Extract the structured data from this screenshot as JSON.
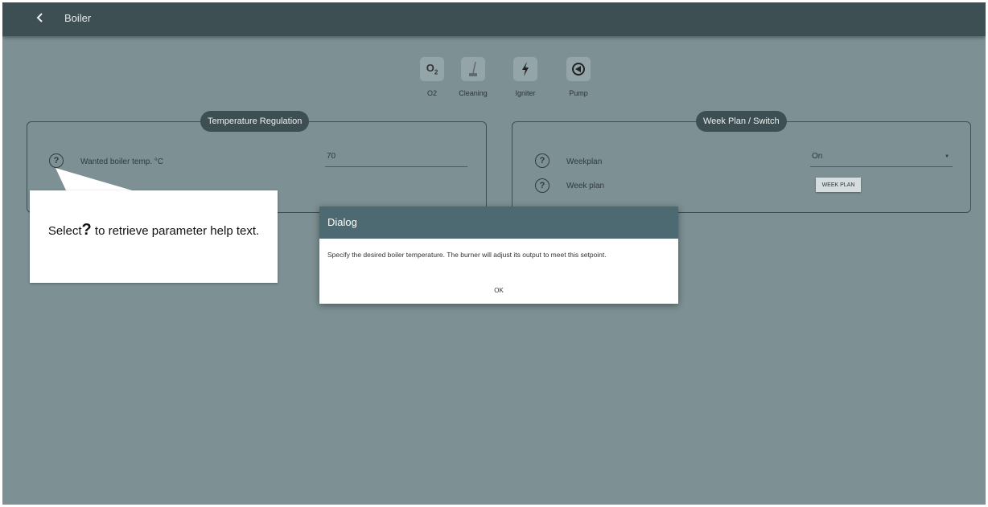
{
  "header": {
    "back_icon": "chevron-left-icon",
    "title": "Boiler"
  },
  "devices": [
    {
      "label": "O2",
      "icon": "o2-icon"
    },
    {
      "label": "Cleaning",
      "icon": "broom-icon"
    },
    {
      "label": "Igniter",
      "icon": "lightning-icon"
    },
    {
      "label": "Pump",
      "icon": "pump-icon"
    }
  ],
  "temp_panel": {
    "title": "Temperature Regulation",
    "param_label": "Wanted boiler temp. °C",
    "value": "70"
  },
  "week_panel": {
    "title": "Week Plan / Switch",
    "weekplan_label": "Weekplan",
    "weekplan_value": "On",
    "week_plan_label": "Week plan",
    "week_plan_button": "WEEK PLAN"
  },
  "callout": {
    "text_before": "Select",
    "symbol": "?",
    "text_after": " to retrieve parameter help text."
  },
  "dialog": {
    "title": "Dialog",
    "message": "Specify the desired boiler temperature. The burner will adjust its output to meet this setpoint.",
    "ok_label": "OK"
  },
  "colors": {
    "header": "#3e4f53",
    "background": "#7d9093",
    "dialog_header": "#4d6a72"
  }
}
